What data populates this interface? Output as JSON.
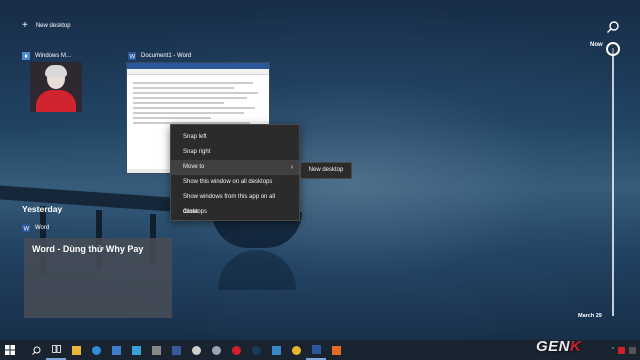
{
  "top": {
    "new_desktop_label": "New desktop",
    "plus_glyph": "+"
  },
  "windows": [
    {
      "title": "Windows M...",
      "icon": "media-app-icon"
    },
    {
      "title": "Document1 - Word",
      "icon": "word-icon"
    }
  ],
  "context_menu": {
    "items": [
      "Snap left",
      "Snap right",
      "Move to",
      "Show this window on all desktops",
      "Show windows from this app on all desktops",
      "Close"
    ],
    "submenu_item": "New desktop"
  },
  "yesterday": {
    "heading": "Yesterday",
    "app_label": "Word",
    "card_title": "Word - Dùng thử Why Pay"
  },
  "timeline": {
    "now_label": "Now",
    "date_label": "March 29"
  },
  "watermark": {
    "part1": "GEN",
    "part2": "K"
  },
  "colors": {
    "accent": "#2b579a",
    "menu_bg": "#2b2b2b",
    "taskbar": "#1a2330"
  }
}
